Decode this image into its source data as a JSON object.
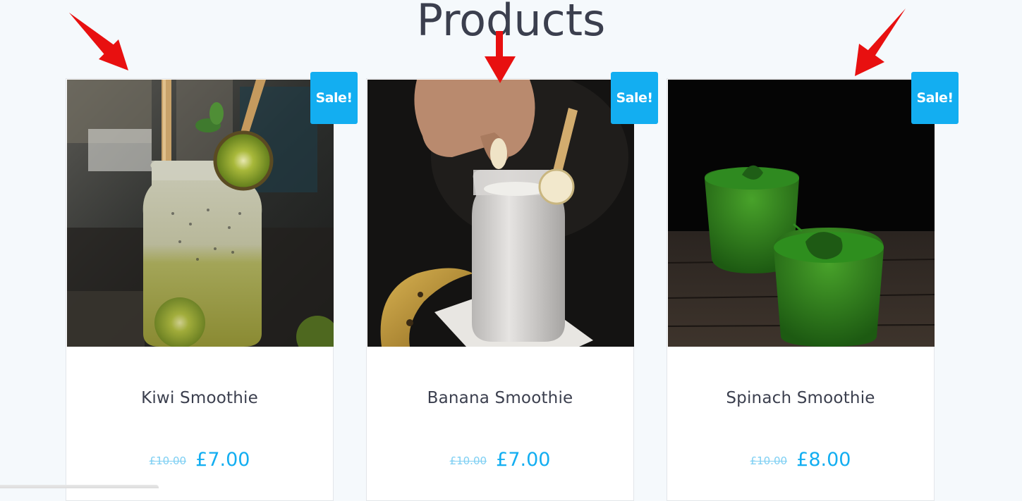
{
  "page": {
    "title": "Products"
  },
  "products": [
    {
      "name": "Kiwi Smoothie",
      "badge": "Sale!",
      "old_price": "£10.00",
      "new_price": "£7.00",
      "image": "kiwi-smoothie-photo"
    },
    {
      "name": "Banana Smoothie",
      "badge": "Sale!",
      "old_price": "£10.00",
      "new_price": "£7.00",
      "image": "banana-smoothie-photo"
    },
    {
      "name": "Spinach Smoothie",
      "badge": "Sale!",
      "old_price": "£10.00",
      "new_price": "£8.00",
      "image": "spinach-smoothie-photo"
    }
  ],
  "colors": {
    "accent": "#13aef1",
    "title": "#3b3f4e",
    "background": "#f5f9fc",
    "annotation_arrow": "#e81010"
  }
}
